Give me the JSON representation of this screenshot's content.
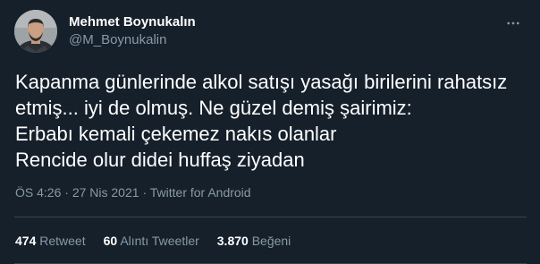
{
  "author": {
    "display_name": "Mehmet Boynukalın",
    "handle": "@M_Boynukalin",
    "avatar_icon": "profile-photo"
  },
  "tweet": {
    "lines": [
      "Kapanma günlerinde alkol satışı yasağı birilerini rahatsız",
      "etmiş... iyi de olmuş. Ne güzel demiş şairimiz:",
      "Erbabı kemali çekemez nakıs olanlar",
      "Rencide olur didei huffaş ziyadan"
    ]
  },
  "meta": {
    "time": "ÖS 4:26",
    "separator": "·",
    "date": "27 Nis 2021",
    "source": "Twitter for Android"
  },
  "stats": {
    "retweets": {
      "count": "474",
      "label": "Retweet"
    },
    "quotes": {
      "count": "60",
      "label": "Alıntı Tweetler"
    },
    "likes": {
      "count": "3.870",
      "label": "Beğeni"
    }
  },
  "colors": {
    "background": "#15202b",
    "text": "#ffffff",
    "secondary": "#8899a6",
    "divider": "#38444d"
  },
  "icons": {
    "more": "more-options-icon"
  }
}
